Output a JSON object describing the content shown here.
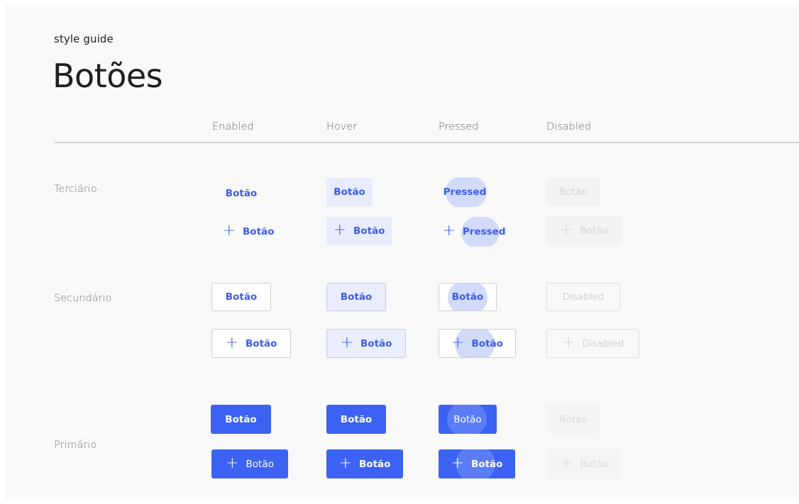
{
  "header": {
    "eyebrow": "style guide",
    "title": "Botões"
  },
  "columns": [
    "Enabled",
    "Hover",
    "Pressed",
    "Disabled"
  ],
  "rows": {
    "terciario": {
      "label": "Terciário",
      "enabled": "Botão",
      "hover": "Botão",
      "pressed": "Pressed",
      "disabled": "Botão",
      "icon_enabled": "Botão",
      "icon_hover": "Botão",
      "icon_pressed": "Pressed",
      "icon_disabled": "Botão"
    },
    "secundario": {
      "label": "Secundário",
      "enabled": "Botão",
      "hover": "Botão",
      "pressed": "Botão",
      "disabled": "Disabled",
      "icon_enabled": "Botão",
      "icon_hover": "Botão",
      "icon_pressed": "Botão",
      "icon_disabled": "Disabled"
    },
    "primario": {
      "label": "Primário",
      "enabled": "Botão",
      "hover": "Botão",
      "pressed": "Botão",
      "disabled": "Botão",
      "icon_enabled": "Botão",
      "icon_hover": "Botão",
      "icon_pressed": "Botão",
      "icon_disabled": "Botão"
    }
  },
  "icons": {
    "add": "plus-icon"
  },
  "colors": {
    "accent": "#3b62f2",
    "hover_tint": "#e8ecfc",
    "ripple": "#d3dbfb",
    "disabled_text": "#d6d6d6"
  }
}
